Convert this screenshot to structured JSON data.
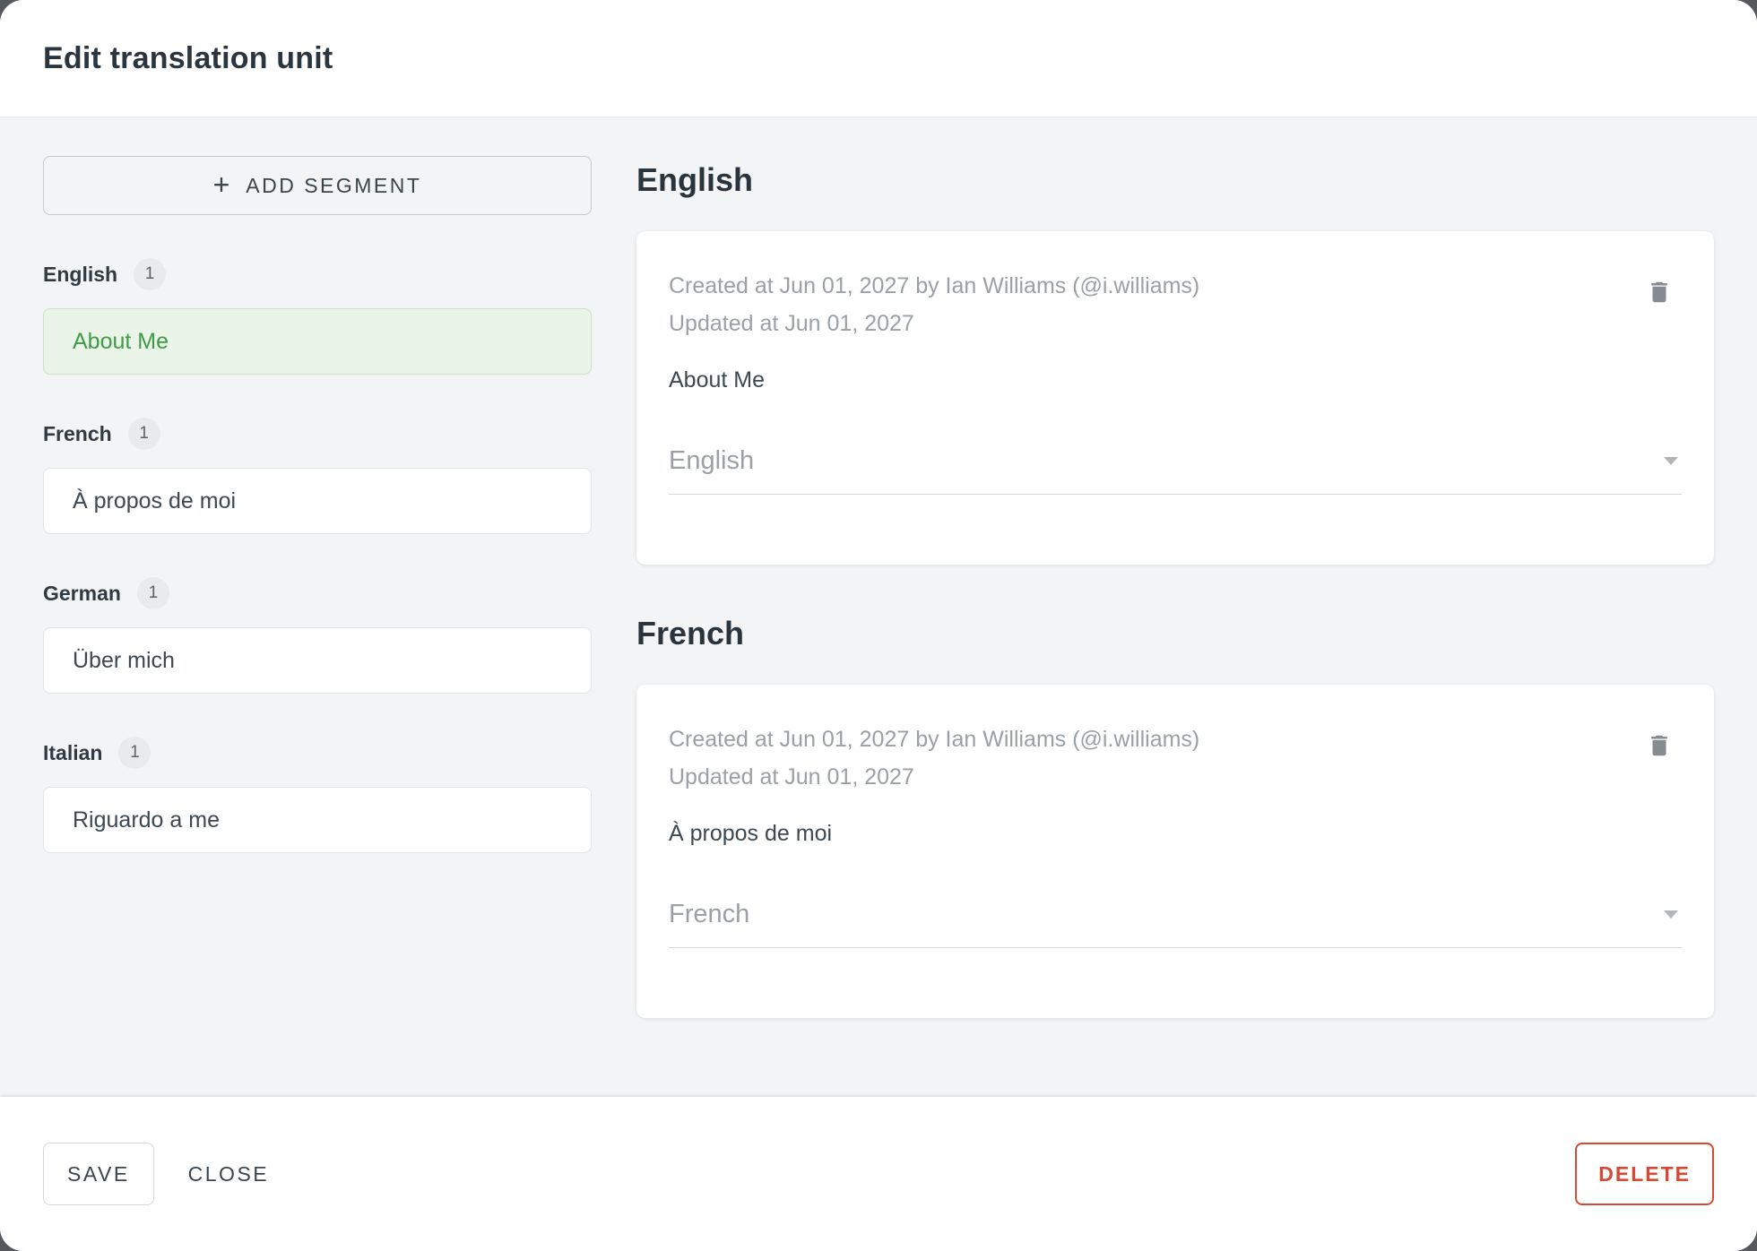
{
  "dialog": {
    "title": "Edit translation unit"
  },
  "sidebar": {
    "add_segment": {
      "icon": "+",
      "label": "ADD SEGMENT"
    },
    "groups": [
      {
        "language": "English",
        "count": "1",
        "segment_text": "About Me",
        "selected": true
      },
      {
        "language": "French",
        "count": "1",
        "segment_text": "À propos de moi",
        "selected": false
      },
      {
        "language": "German",
        "count": "1",
        "segment_text": "Über mich",
        "selected": false
      },
      {
        "language": "Italian",
        "count": "1",
        "segment_text": "Riguardo a me",
        "selected": false
      }
    ]
  },
  "main": {
    "sections": [
      {
        "heading": "English",
        "created": "Created at Jun 01, 2027 by Ian Williams (@i.williams)",
        "updated": "Updated at Jun 01, 2027",
        "segment_text": "About Me",
        "language_value": "English"
      },
      {
        "heading": "French",
        "created": "Created at Jun 01, 2027 by Ian Williams (@i.williams)",
        "updated": "Updated at Jun 01, 2027",
        "segment_text": "À propos de moi",
        "language_value": "French"
      }
    ]
  },
  "footer": {
    "save": "SAVE",
    "close": "CLOSE",
    "delete": "DELETE"
  },
  "icons": {
    "add": "plus-icon",
    "segment_delete": "trash-icon",
    "language_dropdown": "chevron-down-icon"
  },
  "colors": {
    "active_segment_text": "#3f9b46",
    "active_segment_bg": "#eaf4e8",
    "delete_accent": "#d64a33",
    "body_bg": "#f3f4f6"
  }
}
